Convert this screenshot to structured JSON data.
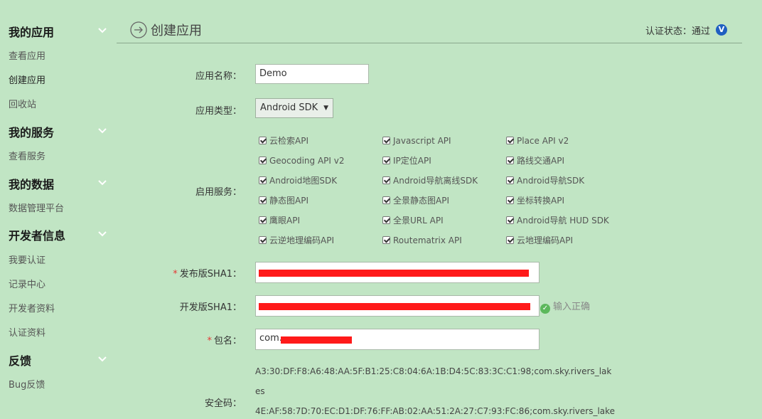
{
  "sidebar": {
    "groups": [
      {
        "title": "我的应用",
        "items": [
          "查看应用",
          "创建应用",
          "回收站"
        ]
      },
      {
        "title": "我的服务",
        "items": [
          "查看服务"
        ]
      },
      {
        "title": "我的数据",
        "items": [
          "数据管理平台"
        ]
      },
      {
        "title": "开发者信息",
        "items": [
          "我要认证",
          "记录中心",
          "开发者资料",
          "认证资料"
        ]
      },
      {
        "title": "反馈",
        "items": [
          "Bug反馈"
        ]
      }
    ]
  },
  "header": {
    "title": "创建应用",
    "status_label": "认证状态：通过",
    "badge": "V"
  },
  "form": {
    "app_name_label": "应用名称：",
    "app_name_value": "Demo",
    "app_type_label": "应用类型：",
    "app_type_value": "Android SDK",
    "services_label": "启用服务：",
    "services": [
      "云检索API",
      "Javascript API",
      "Place API v2",
      "Geocoding API v2",
      "IP定位API",
      "路线交通API",
      "Android地图SDK",
      "Android导航离线SDK",
      "Android导航SDK",
      "静态图API",
      "全景静态图API",
      "坐标转换API",
      "鹰眼API",
      "全景URL API",
      "Android导航 HUD SDK",
      "云逆地理编码API",
      "Routematrix API",
      "云地理编码API"
    ],
    "release_sha1_label": "发布版SHA1：",
    "dev_sha1_label": "开发版SHA1：",
    "dev_sha1_status": "输入正确",
    "package_label": "包名：",
    "package_value": "com.",
    "required_mark": "*",
    "security_label": "安全码：",
    "security_lines": [
      "A3:30:DF:F8:A6:48:AA:5F:B1:25:C8:04:6A:1B:D4:5C:83:3C:C1:98;com.sky.rivers_lak",
      "es",
      "4E:AF:58:7D:70:EC:D1:DF:76:FF:AB:02:AA:51:2A:27:C7:93:FC:86;com.sky.rivers_lake"
    ]
  },
  "colors": {
    "background": "#c1e5c4",
    "redaction": "#ff1a1a",
    "badge": "#1f5fc1",
    "ok": "#5cb85c"
  }
}
